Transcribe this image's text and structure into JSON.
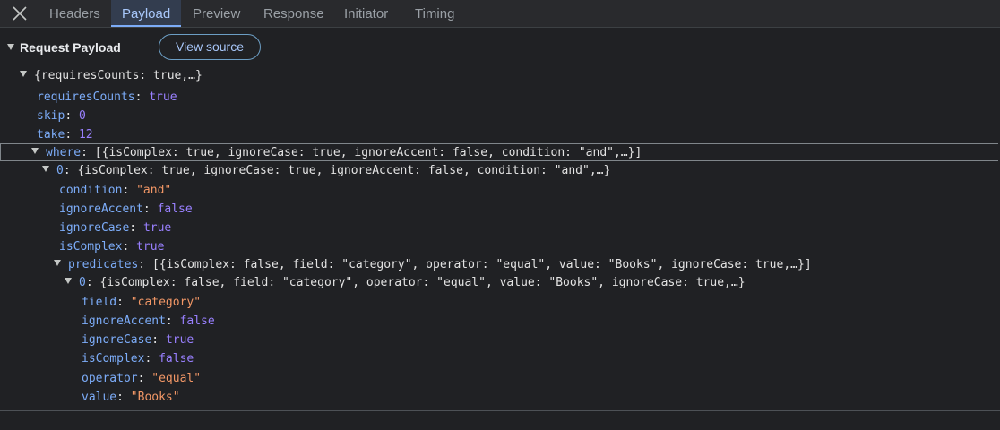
{
  "tabs": [
    {
      "label": "Headers"
    },
    {
      "label": "Payload"
    },
    {
      "label": "Preview"
    },
    {
      "label": "Response"
    },
    {
      "label": "Initiator"
    },
    {
      "label": "Timing"
    }
  ],
  "active_tab": "Payload",
  "section": {
    "title": "Request Payload",
    "view_source_label": "View source"
  },
  "tree": {
    "root_summary": "{requiresCounts: true,…}",
    "requiresCounts": {
      "key": "requiresCounts",
      "value": "true"
    },
    "skip": {
      "key": "skip",
      "value": "0"
    },
    "take": {
      "key": "take",
      "value": "12"
    },
    "where": {
      "key": "where",
      "summary": "[{isComplex: true, ignoreCase: true, ignoreAccent: false, condition: \"and\",…}]",
      "item0": {
        "key": "0",
        "summary": "{isComplex: true, ignoreCase: true, ignoreAccent: false, condition: \"and\",…}",
        "condition": {
          "key": "condition",
          "value": "\"and\""
        },
        "ignoreAccent": {
          "key": "ignoreAccent",
          "value": "false"
        },
        "ignoreCase": {
          "key": "ignoreCase",
          "value": "true"
        },
        "isComplex": {
          "key": "isComplex",
          "value": "true"
        },
        "predicates": {
          "key": "predicates",
          "summary": "[{isComplex: false, field: \"category\", operator: \"equal\", value: \"Books\", ignoreCase: true,…}]",
          "item0": {
            "key": "0",
            "summary": "{isComplex: false, field: \"category\", operator: \"equal\", value: \"Books\", ignoreCase: true,…}",
            "field": {
              "key": "field",
              "value": "\"category\""
            },
            "ignoreAccent": {
              "key": "ignoreAccent",
              "value": "false"
            },
            "ignoreCase": {
              "key": "ignoreCase",
              "value": "true"
            },
            "isComplex": {
              "key": "isComplex",
              "value": "false"
            },
            "operator": {
              "key": "operator",
              "value": "\"equal\""
            },
            "value": {
              "key": "value",
              "value": "\"Books\""
            }
          }
        }
      }
    }
  },
  "colors": {
    "key": "#7cacf8",
    "string": "#f29766",
    "boolean": "#9980ff",
    "active_tab": "#a8c7fa"
  },
  "icons": {
    "close": "close-icon",
    "expand": "triangle-down-icon"
  }
}
